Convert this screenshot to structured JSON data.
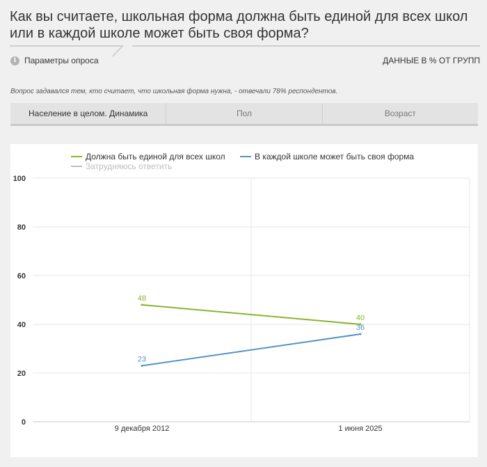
{
  "question": "Как вы считаете, школьная форма должна быть единой для всех школ или в каждой школе может быть своя форма?",
  "params_label": "Параметры опроса",
  "units_label": "ДАННЫЕ В % ОТ ГРУПП",
  "note": "Вопрос задавался тем, кто считает, что школьная форма нужна, - отвечали 78% респондентов.",
  "tabs": [
    {
      "label": "Население в целом. Динамика",
      "active": true
    },
    {
      "label": "Пол",
      "active": false
    },
    {
      "label": "Возраст",
      "active": false
    }
  ],
  "colors": {
    "series_1": "#8ab52a",
    "series_2": "#5594c2",
    "series_3": "#bdbdbd"
  },
  "icons": {
    "info": "info-icon"
  },
  "chart_data": {
    "type": "line",
    "x": [
      "9 декабря 2012",
      "1 июня 2025"
    ],
    "ylim": [
      0,
      100
    ],
    "yticks": [
      0,
      20,
      40,
      60,
      80,
      100
    ],
    "legend_position": "top",
    "grid": true,
    "series": [
      {
        "name": "Должна быть единой для всех школ",
        "values": [
          48,
          40
        ],
        "color": "#8ab52a",
        "visible": true
      },
      {
        "name": "В каждой школе может быть своя форма",
        "values": [
          23,
          36
        ],
        "color": "#5594c2",
        "visible": true
      },
      {
        "name": "Затрудняюсь ответить",
        "values": [
          null,
          null
        ],
        "color": "#bdbdbd",
        "visible": false
      }
    ]
  }
}
